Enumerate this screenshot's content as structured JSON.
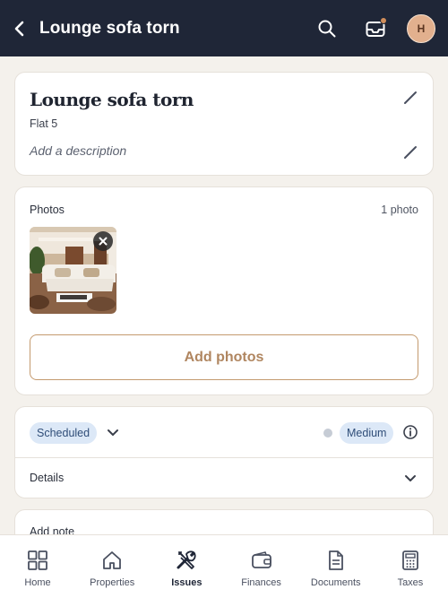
{
  "header": {
    "title": "Lounge sofa torn",
    "avatar_initial": "H",
    "notification_dot_color": "#d08d5a",
    "background_color": "#1f2637"
  },
  "issue": {
    "title": "Lounge sofa torn",
    "property": "Flat 5",
    "description_placeholder": "Add a description"
  },
  "photos": {
    "label": "Photos",
    "count": "1 photo",
    "add_button": "Add photos"
  },
  "status": {
    "status_value": "Scheduled",
    "priority_value": "Medium",
    "details_label": "Details"
  },
  "note": {
    "label": "Add note"
  },
  "bottom_nav": {
    "items": [
      {
        "label": "Home",
        "icon": "grid-icon"
      },
      {
        "label": "Properties",
        "icon": "house-icon"
      },
      {
        "label": "Issues",
        "icon": "tools-icon",
        "active": true
      },
      {
        "label": "Finances",
        "icon": "wallet-icon"
      },
      {
        "label": "Documents",
        "icon": "document-icon"
      },
      {
        "label": "Taxes",
        "icon": "calculator-icon"
      }
    ]
  },
  "colors": {
    "accent": "#c49a6e",
    "pill_bg": "#dce8f7",
    "pill_text": "#2f4d78"
  }
}
